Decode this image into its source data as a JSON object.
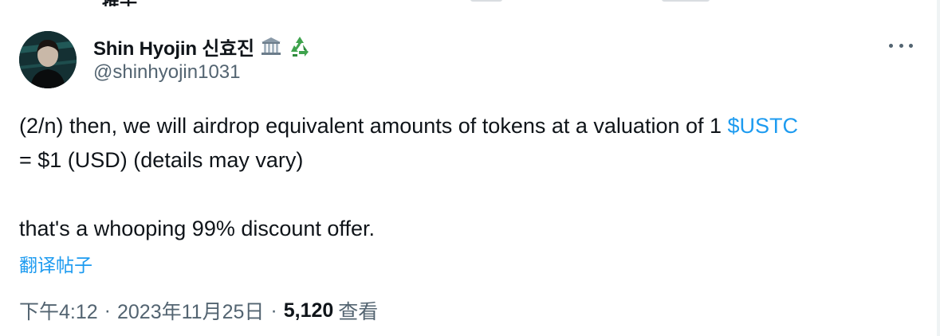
{
  "header_fragment": "推子",
  "author": {
    "display_name": "Shin Hyojin 신효진",
    "handle": "@shinhyojin1031",
    "badge_icons": [
      "bank-building-icon",
      "recycle-icon"
    ]
  },
  "more_icon": "more-horizontal-icon",
  "tweet": {
    "line1_before": "(2/n) then, we will airdrop equivalent amounts of tokens at a valuation of 1 ",
    "cashtag": "$USTC",
    "line2": "= $1 (USD) (details may vary)",
    "line3": "that's a whooping 99% discount offer."
  },
  "translate_label": "翻译帖子",
  "meta": {
    "time": "下午4:12",
    "separator": "·",
    "date": "2023年11月25日",
    "views_count": "5,120",
    "views_label": "查看"
  },
  "colors": {
    "link": "#1d9bf0",
    "secondary_text": "#536471",
    "primary_text": "#0f1419"
  }
}
